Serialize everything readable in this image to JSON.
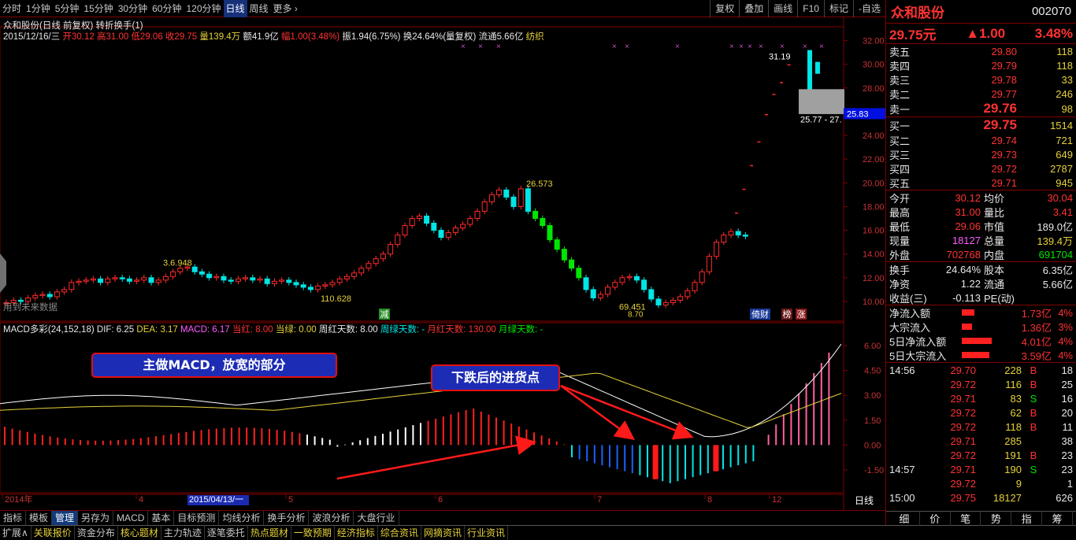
{
  "toolbar": {
    "periods": [
      "分时",
      "1分钟",
      "5分钟",
      "15分钟",
      "30分钟",
      "60分钟",
      "120分钟",
      "日线",
      "周线",
      "更多"
    ],
    "active_period": "日线",
    "tools": [
      "复权",
      "叠加",
      "画线",
      "F10",
      "标记",
      "-自选"
    ]
  },
  "stock": {
    "title": "众和股份(日线 前复权) 转折换手(1)",
    "info_date": "2015/12/16/三",
    "info_open": "开30.12",
    "info_high": "高31.00",
    "info_low": "低29.06",
    "info_close": "收29.75",
    "info_vol": "量139.4万",
    "info_amount": "额41.9亿",
    "info_change": "幅1.00(3.48%)",
    "info_amp": "振1.94(6.75%)",
    "info_turnover": "换24.64%(量复权)",
    "info_float": "流通5.66亿",
    "info_industry": "纺织",
    "future_data": "用到未来数据"
  },
  "chart_annotations": {
    "high_label": "26.573",
    "mid_label": "3.6.948",
    "low1_label": "110.628",
    "low2_label": "69.451",
    "low2_sub": "8.70",
    "last_label": "31.19",
    "range_label": "25.77 - 27.",
    "price_tag": "25.83",
    "tag_jian": "减",
    "tag_daicai": "倚财",
    "tag_bang": "榜",
    "tag_zhang": "涨"
  },
  "price_axis": [
    "32.00",
    "30.00",
    "28.00",
    "26.00",
    "24.00",
    "22.00",
    "20.00",
    "18.00",
    "16.00",
    "14.00",
    "12.00",
    "10.00"
  ],
  "macd": {
    "title": "MACD多彩(24,152,18)",
    "dif": "DIF: 6.25",
    "dea": "DEA: 3.17",
    "macd": "MACD: 6.17",
    "dang_hong": "当红: 8.00",
    "dang_lv": "当绿: 0.00",
    "zhou_hong": "周红天数: 8.00",
    "zhou_lv": "周绿天数: -",
    "yue_hong": "月红天数: 130.00",
    "yue_lv": "月绿天数: -",
    "axis": [
      "6.00",
      "4.50",
      "3.00",
      "1.50",
      "0.00",
      "-1.50"
    ]
  },
  "callouts": {
    "one": "主做MACD，放宽的部分",
    "two": "下跌后的进货点"
  },
  "date_axis": {
    "labels": [
      "2014年",
      "4",
      "2015/04/13/一",
      "5",
      "6",
      "7",
      "8",
      "12"
    ],
    "period": "日线"
  },
  "bottom_tabs": [
    "指标",
    "模板",
    "管理",
    "另存为",
    "MACD",
    "基本",
    "目标预测",
    "均线分析",
    "换手分析",
    "波浪分析",
    "大盘行业"
  ],
  "bottom_active": "管理",
  "bottom_tabs2": [
    "扩展∧",
    "关联报价",
    "资金分布",
    "核心题材",
    "主力轨迹",
    "逐笔委托",
    "热点题材",
    "一致预期",
    "经济指标",
    "综合资讯",
    "网摘资讯",
    "行业资讯"
  ],
  "panel": {
    "name": "众和股份",
    "code": "002070",
    "price": "29.75元",
    "change": "▲1.00",
    "pct": "3.48%",
    "asks": [
      {
        "label": "卖五",
        "price": "29.80",
        "vol": "118"
      },
      {
        "label": "卖四",
        "price": "29.79",
        "vol": "118"
      },
      {
        "label": "卖三",
        "price": "29.78",
        "vol": "33"
      },
      {
        "label": "卖二",
        "price": "29.77",
        "vol": "246"
      },
      {
        "label": "卖一",
        "price": "29.76",
        "vol": "98"
      }
    ],
    "bids": [
      {
        "label": "买一",
        "price": "29.75",
        "vol": "1514"
      },
      {
        "label": "买二",
        "price": "29.74",
        "vol": "721"
      },
      {
        "label": "买三",
        "price": "29.73",
        "vol": "649"
      },
      {
        "label": "买四",
        "price": "29.72",
        "vol": "2787"
      },
      {
        "label": "买五",
        "price": "29.71",
        "vol": "945"
      }
    ],
    "stats": [
      {
        "l1": "今开",
        "v1": "30.12",
        "l2": "均价",
        "v2": "30.04"
      },
      {
        "l1": "最高",
        "v1": "31.00",
        "l2": "量比",
        "v2": "3.41"
      },
      {
        "l1": "最低",
        "v1": "29.06",
        "l2": "市值",
        "v2": "189.0亿"
      },
      {
        "l1": "现量",
        "v1": "18127",
        "l2": "总量",
        "v2": "139.4万"
      },
      {
        "l1": "外盘",
        "v1": "702768",
        "l2": "内盘",
        "v2": "691704"
      }
    ],
    "stats2": [
      {
        "l1": "换手",
        "v1": "24.64%",
        "l2": "股本",
        "v2": "6.35亿"
      },
      {
        "l1": "净资",
        "v1": "1.22",
        "l2": "流通",
        "v2": "5.66亿"
      },
      {
        "l1": "收益(三)",
        "v1": "-0.113",
        "l2": "PE(动)",
        "v2": ""
      }
    ],
    "flows": [
      {
        "label": "净流入额",
        "value": "1.73亿",
        "pct": "4%",
        "bar": 0.25
      },
      {
        "label": "大宗流入",
        "value": "1.36亿",
        "pct": "3%",
        "bar": 0.2
      },
      {
        "label": "5日净流入额",
        "value": "4.01亿",
        "pct": "4%",
        "bar": 0.6
      },
      {
        "label": "5日大宗流入",
        "value": "3.59亿",
        "pct": "4%",
        "bar": 0.55
      }
    ],
    "ticks": [
      {
        "time": "14:56",
        "price": "29.70",
        "vol": "228",
        "bs": "B",
        "n": "18"
      },
      {
        "time": "",
        "price": "29.72",
        "vol": "116",
        "bs": "B",
        "n": "25"
      },
      {
        "time": "",
        "price": "29.71",
        "vol": "83",
        "bs": "S",
        "n": "16"
      },
      {
        "time": "",
        "price": "29.72",
        "vol": "62",
        "bs": "B",
        "n": "20"
      },
      {
        "time": "",
        "price": "29.72",
        "vol": "118",
        "bs": "B",
        "n": "11"
      },
      {
        "time": "",
        "price": "29.71",
        "vol": "285",
        "bs": "",
        "n": "38"
      },
      {
        "time": "",
        "price": "29.72",
        "vol": "191",
        "bs": "B",
        "n": "23"
      },
      {
        "time": "14:57",
        "price": "29.71",
        "vol": "190",
        "bs": "S",
        "n": "23"
      },
      {
        "time": "",
        "price": "29.72",
        "vol": "9",
        "bs": "",
        "n": "1"
      },
      {
        "time": "15:00",
        "price": "29.75",
        "vol": "18127",
        "bs": "",
        "n": "626"
      }
    ],
    "bottom_tabs": [
      "细",
      "价",
      "笔",
      "势",
      "指",
      "筹"
    ]
  }
}
